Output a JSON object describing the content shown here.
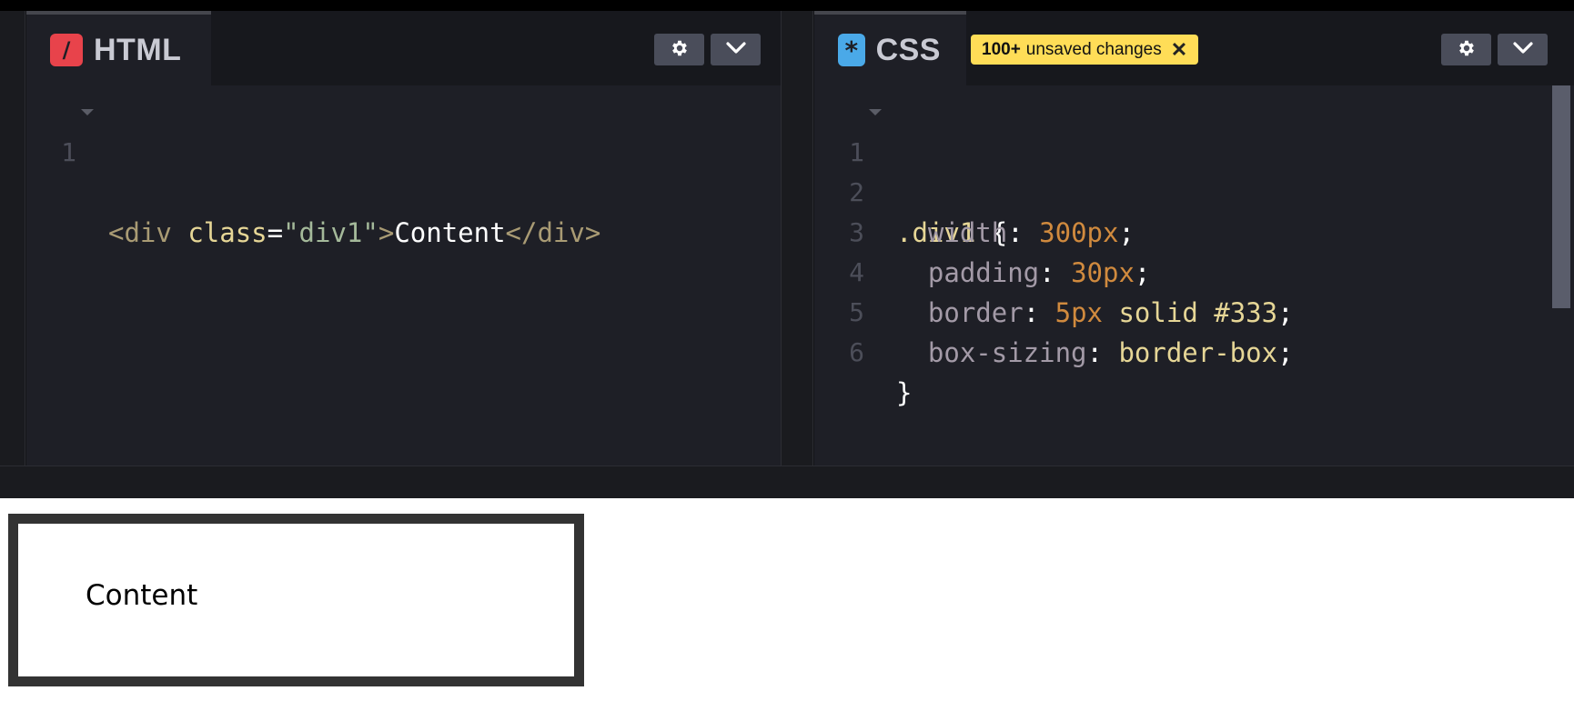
{
  "html_panel": {
    "title": "HTML",
    "icon": "slash-icon",
    "icon_glyph": "/",
    "lines": [
      {
        "num": "1"
      }
    ],
    "code_tokens": {
      "open_tag": "<div",
      "attr": "class",
      "eq": "=",
      "value": "\"div1\"",
      "close_bracket": ">",
      "content": "Content",
      "end_tag": "</div>"
    }
  },
  "css_panel": {
    "title": "CSS",
    "icon": "asterisk-icon",
    "icon_glyph": "*",
    "unsaved_badge": {
      "count": "100+",
      "text": "unsaved changes",
      "close_glyph": "✕"
    },
    "line_numbers": [
      "1",
      "2",
      "3",
      "4",
      "5",
      "6"
    ],
    "selector": ".div1",
    "open_brace": "{",
    "close_brace": "}",
    "declarations": [
      {
        "prop": "width",
        "colon": ":",
        "num": "300px",
        "rest": "",
        "semi": ";"
      },
      {
        "prop": "padding",
        "colon": ":",
        "num": "30px",
        "rest": "",
        "semi": ";"
      },
      {
        "prop": "border",
        "colon": ":",
        "num": "5px",
        "rest": " solid #333",
        "semi": ";"
      },
      {
        "prop": "box-sizing",
        "colon": ":",
        "num": "",
        "rest": "border-box",
        "semi": ";"
      }
    ]
  },
  "preview": {
    "content_text": "Content"
  },
  "colors": {
    "html_accent": "#e8434b",
    "css_accent": "#4aa9e8",
    "badge": "#ffdd57",
    "editor_bg": "#1e1f26"
  }
}
